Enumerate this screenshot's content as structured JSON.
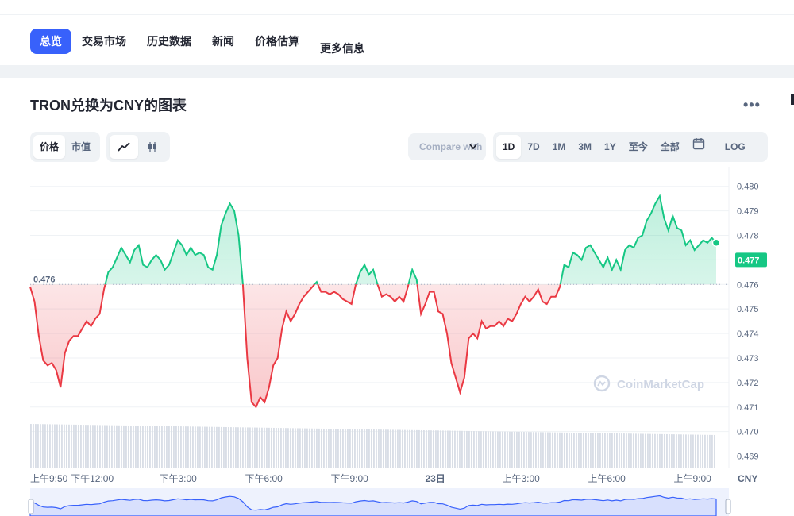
{
  "tabs": [
    "总览",
    "交易市场",
    "历史数据",
    "新闻",
    "价格估算",
    "更多信息"
  ],
  "title": "TRON兑换为CNY的图表",
  "more": "•••",
  "type_toggle": [
    "价格",
    "市值"
  ],
  "compare_label": "Compare with",
  "ranges": [
    "1D",
    "7D",
    "1M",
    "3M",
    "1Y",
    "至今",
    "全部"
  ],
  "log_label": "LOG",
  "icons": {
    "line": "line-chart-icon",
    "candle": "candlestick-icon",
    "calendar": "calendar-icon",
    "chevron": "chevron-down-icon",
    "watermark": "coinmarketcap-logo-icon"
  },
  "colors": {
    "up": "#16c784",
    "down": "#ea3943",
    "accent": "#3861fb",
    "current": "#16c784"
  },
  "chart_data": {
    "type": "area",
    "baseline": 0.476,
    "baseline_label": "0.476",
    "current_price": 0.477,
    "current_label": "0.477",
    "currency": "CNY",
    "watermark": "CoinMarketCap",
    "ylim": [
      0.4685,
      0.4808
    ],
    "y_ticks": [
      "0.480",
      "0.479",
      "0.478",
      "0.477",
      "0.476",
      "0.475",
      "0.474",
      "0.473",
      "0.472",
      "0.471",
      "0.470",
      "0.469"
    ],
    "x_ticks": [
      "上午9:50",
      "下午12:00",
      "下午3:00",
      "下午6:00",
      "下午9:00",
      "23日",
      "上午3:00",
      "上午6:00",
      "上午9:00"
    ],
    "x_tick_pos": [
      0,
      2.17,
      5.17,
      8.17,
      11.17,
      14.17,
      17.17,
      20.17,
      23.17
    ],
    "x_range": [
      0,
      24.0
    ],
    "prices": [
      0.4759,
      0.4753,
      0.4739,
      0.4729,
      0.4727,
      0.4728,
      0.4725,
      0.4718,
      0.4732,
      0.4737,
      0.4739,
      0.4739,
      0.4742,
      0.4745,
      0.4743,
      0.4746,
      0.4748,
      0.4758,
      0.4765,
      0.4767,
      0.4771,
      0.4775,
      0.4772,
      0.4769,
      0.4774,
      0.4776,
      0.4768,
      0.4767,
      0.477,
      0.4772,
      0.477,
      0.4766,
      0.4768,
      0.4773,
      0.4778,
      0.4776,
      0.4772,
      0.4775,
      0.4772,
      0.4773,
      0.4772,
      0.4767,
      0.4766,
      0.4772,
      0.4784,
      0.4789,
      0.4793,
      0.479,
      0.478,
      0.476,
      0.473,
      0.4712,
      0.471,
      0.4714,
      0.4712,
      0.4718,
      0.4727,
      0.473,
      0.4742,
      0.4749,
      0.4745,
      0.4748,
      0.4752,
      0.4755,
      0.4757,
      0.4759,
      0.4761,
      0.4757,
      0.4757,
      0.4756,
      0.4757,
      0.4756,
      0.4754,
      0.4753,
      0.4752,
      0.476,
      0.4765,
      0.4768,
      0.4764,
      0.4766,
      0.476,
      0.4755,
      0.4756,
      0.4755,
      0.4753,
      0.4755,
      0.4753,
      0.4759,
      0.4766,
      0.4762,
      0.4748,
      0.4752,
      0.4757,
      0.4757,
      0.4749,
      0.4748,
      0.474,
      0.4728,
      0.4722,
      0.4716,
      0.4722,
      0.4738,
      0.474,
      0.4738,
      0.4745,
      0.4742,
      0.4743,
      0.4743,
      0.4745,
      0.4743,
      0.4746,
      0.4745,
      0.4748,
      0.4752,
      0.4755,
      0.4753,
      0.4755,
      0.4758,
      0.4753,
      0.4752,
      0.4755,
      0.4755,
      0.4759,
      0.4768,
      0.4767,
      0.4773,
      0.4772,
      0.477,
      0.4775,
      0.4776,
      0.4773,
      0.477,
      0.4767,
      0.4771,
      0.4766,
      0.477,
      0.4766,
      0.4774,
      0.4776,
      0.4775,
      0.4779,
      0.478,
      0.4786,
      0.4789,
      0.4793,
      0.4796,
      0.4787,
      0.4782,
      0.4788,
      0.4783,
      0.4782,
      0.4776,
      0.4778,
      0.4774,
      0.4776,
      0.4778,
      0.4777,
      0.4779,
      0.4777
    ],
    "volume_note": "grey volume bars along the bottom"
  }
}
